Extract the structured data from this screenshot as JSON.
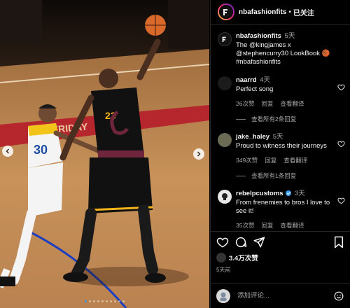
{
  "header": {
    "username": "nbafashionfits",
    "separator": "•",
    "follow_status": "已关注"
  },
  "caption": {
    "username": "nbafashionfits",
    "time": "5天",
    "text": "The @kingjames x @stephencurry30 LookBook 🏀 #nbafashionfits"
  },
  "comments": [
    {
      "username": "naarrd",
      "time": "4天",
      "text": "Perfect song",
      "likes": "26次赞",
      "reply": "回复",
      "translate": "查看翻译",
      "view_replies": "查看所有2条回复",
      "avatar_color": "#1b1b1b"
    },
    {
      "username": "jake_haley",
      "time": "5天",
      "text": "Proud to witness their journeys",
      "likes": "349次赞",
      "reply": "回复",
      "translate": "查看翻译",
      "view_replies": "查看所有1条回复",
      "avatar_color": "#6b6a55"
    },
    {
      "username": "rebelpcustoms",
      "time": "3天",
      "text": "From frenemies to bros I love to see it!",
      "likes": "35次赞",
      "reply": "回复",
      "translate": "查看翻译",
      "verified": true,
      "avatar_color": "#e8e8e8"
    }
  ],
  "footer": {
    "likes": "3.4万次赞",
    "time_ago": "5天前",
    "comment_placeholder": "添加评论..."
  },
  "photo": {
    "carousel_count": 10,
    "active_index": 0,
    "jersey_number_left": "30",
    "jersey_number_right": "23",
    "court_text": "FRIDAY"
  },
  "colors": {
    "accent": "#3897f0",
    "muted": "#a8a8a8",
    "background": "#000000",
    "cavs_wine": "#6f263d",
    "cavs_gold": "#f4b41a"
  },
  "icons": [
    "heart-icon",
    "comment-icon",
    "share-icon",
    "bookmark-icon",
    "emoji-icon",
    "chevron-left-icon",
    "chevron-right-icon"
  ]
}
